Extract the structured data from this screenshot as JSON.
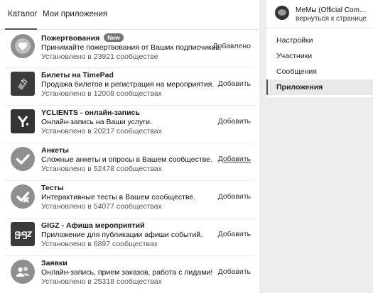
{
  "tabs": [
    {
      "label": "Каталог",
      "active": true
    },
    {
      "label": "Мои приложения",
      "active": false
    }
  ],
  "apps": [
    {
      "name": "Пожертвования",
      "badge": "New",
      "description": "Принимайте пожертвования от Ваших подписчиков.",
      "installed": "Установлено в 23921 сообществе",
      "action": "Добавлено",
      "icon": "heart-icon"
    },
    {
      "name": "Билеты на TimePad",
      "badge": "",
      "description": "Продажа билетов и регистрация на мероприятия.",
      "installed": "Установлено в 12008 сообществах",
      "action": "Добавить",
      "icon": "timepad-icon"
    },
    {
      "name": "YCLIENTS - онлайн-запись",
      "badge": "",
      "description": "Онлайн-запись на Ваши услуги.",
      "installed": "Установлено в 20217 сообществах",
      "action": "Добавить",
      "icon": "yclients-icon"
    },
    {
      "name": "Анкеты",
      "badge": "",
      "description": "Сложные анкеты и опросы в Вашем сообществе.",
      "installed": "Установлено в 52478 сообществах",
      "action": "Добавить",
      "icon": "checkmark-icon"
    },
    {
      "name": "Тесты",
      "badge": "",
      "description": "Интерактивные тесты в Вашем сообществе.",
      "installed": "Установлено в 54077 сообществах",
      "action": "Добавить",
      "icon": "check-cross-icon"
    },
    {
      "name": "GIGZ - Афиша мероприятий",
      "badge": "",
      "description": "Приложение для публикации афиши событий.",
      "installed": "Установлено в 6897 сообществах",
      "action": "Добавить",
      "icon": "gigz-icon"
    },
    {
      "name": "Заявки",
      "badge": "",
      "description": "Онлайн-запись, прием заказов, работа с лидами!",
      "installed": "Установлено в 25318 сообществах",
      "action": "Добавить",
      "icon": "users-icon"
    }
  ],
  "sidebar": {
    "group_name": "МеМы (Official Communit…",
    "back_link": "вернуться к странице",
    "items": [
      {
        "label": "Настройки",
        "active": false
      },
      {
        "label": "Участники",
        "active": false
      },
      {
        "label": "Сообщения",
        "active": false
      },
      {
        "label": "Приложения",
        "active": true
      }
    ]
  },
  "colors": {
    "icon_gray": "#8f8f8f",
    "dark_tile": "#3a3a3a"
  }
}
